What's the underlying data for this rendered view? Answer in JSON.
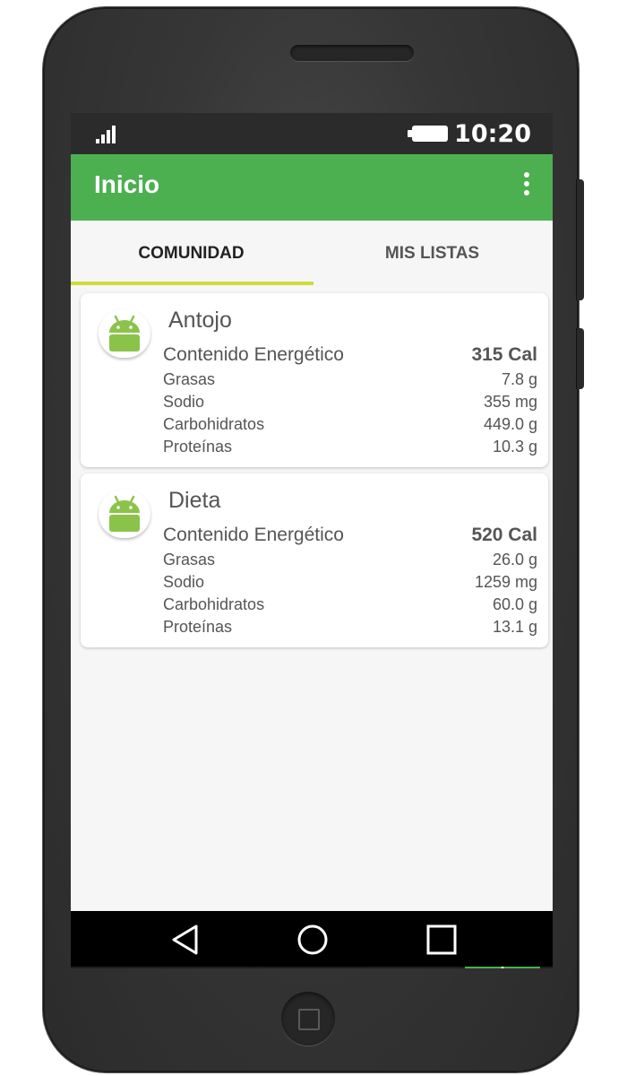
{
  "status_bar": {
    "time": "10:20",
    "signal_icon": "signal-icon",
    "battery_icon": "battery-icon"
  },
  "toolbar": {
    "title": "Inicio",
    "menu_icon": "more-vert-icon",
    "color": "#4caf50"
  },
  "tabs": [
    {
      "label": "COMUNIDAD",
      "selected": true
    },
    {
      "label": "MIS LISTAS",
      "selected": false
    }
  ],
  "tab_indicator_color": "#cddc39",
  "cards": [
    {
      "icon": "android-icon",
      "title": "Antojo",
      "energy_label": "Contenido Energético",
      "energy_value": "315 Cal",
      "nutrients": [
        {
          "label": "Grasas",
          "value": "7.8 g"
        },
        {
          "label": "Sodio",
          "value": "355 mg"
        },
        {
          "label": "Carbohidratos",
          "value": "449.0 g"
        },
        {
          "label": "Proteínas",
          "value": "10.3 g"
        }
      ]
    },
    {
      "icon": "android-icon",
      "title": "Dieta",
      "energy_label": "Contenido Energético",
      "energy_value": "520 Cal",
      "nutrients": [
        {
          "label": "Grasas",
          "value": "26.0 g"
        },
        {
          "label": "Sodio",
          "value": "1259 mg"
        },
        {
          "label": "Carbohidratos",
          "value": "60.0 g"
        },
        {
          "label": "Proteínas",
          "value": "13.1 g"
        }
      ]
    }
  ],
  "fab": {
    "label": "+",
    "icon": "add-icon"
  },
  "nav_bar": {
    "back_icon": "back-triangle-icon",
    "home_icon": "home-circle-icon",
    "recents_icon": "recents-square-icon"
  }
}
